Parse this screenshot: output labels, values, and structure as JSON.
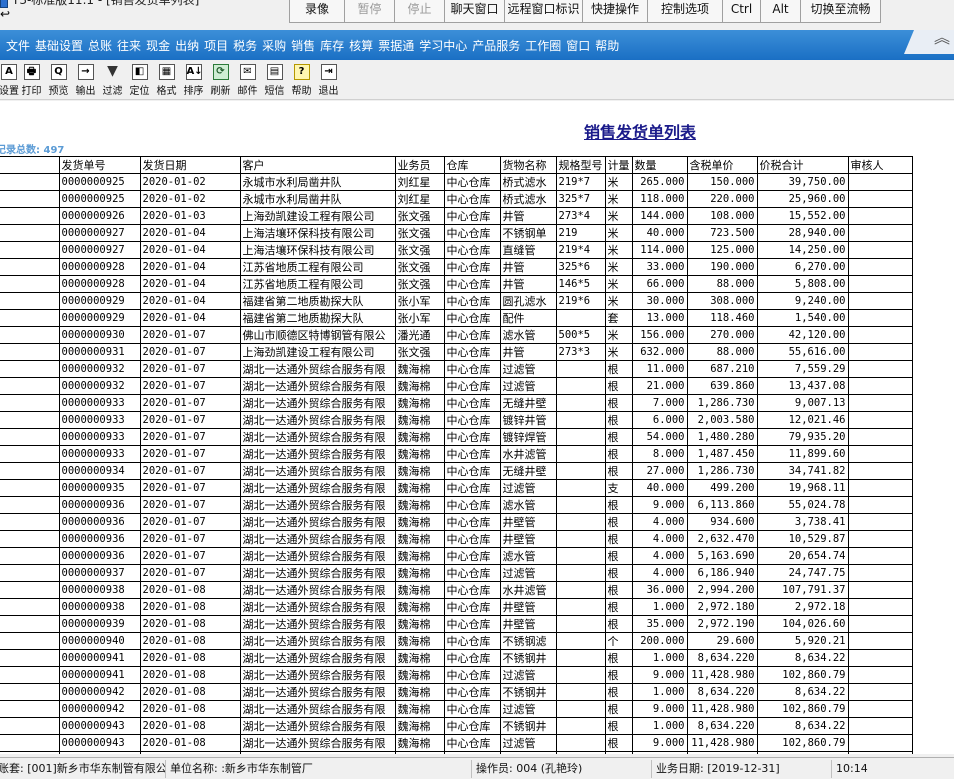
{
  "window": {
    "title": "T3-标准版11.1 - [销售发货单列表]"
  },
  "remote_toolbar": {
    "buttons": [
      {
        "label": "录像",
        "enabled": true
      },
      {
        "label": "暂停",
        "enabled": false
      },
      {
        "label": "停止",
        "enabled": false
      },
      {
        "label": "聊天窗口",
        "enabled": true
      },
      {
        "label": "远程窗口标识",
        "enabled": true
      },
      {
        "label": "快捷操作",
        "enabled": true
      },
      {
        "label": "控制选项",
        "enabled": true
      },
      {
        "label": "Ctrl",
        "enabled": true
      },
      {
        "label": "Alt",
        "enabled": true
      },
      {
        "label": "切换至流畅",
        "enabled": true
      }
    ]
  },
  "menu": {
    "items": [
      "文件",
      "基础设置",
      "总账",
      "往来",
      "现金",
      "出纳",
      "项目",
      "税务",
      "采购",
      "销售",
      "库存",
      "核算",
      "票据通",
      "学习中心",
      "产品服务",
      "工作圈",
      "窗口",
      "帮助"
    ]
  },
  "toolbar": {
    "buttons": [
      {
        "label": "设置",
        "icon": "A"
      },
      {
        "label": "打印",
        "icon": "🖶"
      },
      {
        "label": "预览",
        "icon": "Q"
      },
      {
        "label": "输出",
        "icon": "→"
      },
      {
        "label": "过滤",
        "icon": "▼"
      },
      {
        "label": "定位",
        "icon": "◧"
      },
      {
        "label": "格式",
        "icon": "▦"
      },
      {
        "label": "排序",
        "icon": "A↓"
      },
      {
        "label": "刷新",
        "icon": "⟳"
      },
      {
        "label": "邮件",
        "icon": "✉"
      },
      {
        "label": "短信",
        "icon": "▤"
      },
      {
        "label": "帮助",
        "icon": "?"
      },
      {
        "label": "退出",
        "icon": "⇥"
      }
    ]
  },
  "report": {
    "title": "销售发货单列表",
    "record_count": "记录总数: 497",
    "columns": [
      "发货单号",
      "发货日期",
      "客户",
      "业务员",
      "仓库",
      "货物名称",
      "规格型号",
      "计量",
      "数量",
      "含税单价",
      "价税合计",
      "审核人"
    ],
    "rows": [
      [
        "0000000925",
        "2020-01-02",
        "永城市水利局凿井队",
        "刘红星",
        "中心仓库",
        "桥式滤水",
        "219*7",
        "米",
        "265.000",
        "150.000",
        "39,750.00",
        ""
      ],
      [
        "0000000925",
        "2020-01-02",
        "永城市水利局凿井队",
        "刘红星",
        "中心仓库",
        "桥式滤水",
        "325*7",
        "米",
        "118.000",
        "220.000",
        "25,960.00",
        ""
      ],
      [
        "0000000926",
        "2020-01-03",
        "上海劲凯建设工程有限公司",
        "张文强",
        "中心仓库",
        "井管",
        "273*4",
        "米",
        "144.000",
        "108.000",
        "15,552.00",
        ""
      ],
      [
        "0000000927",
        "2020-01-04",
        "上海洁壤环保科技有限公司",
        "张文强",
        "中心仓库",
        "不锈钢单",
        "219",
        "米",
        "40.000",
        "723.500",
        "28,940.00",
        ""
      ],
      [
        "0000000927",
        "2020-01-04",
        "上海洁壤环保科技有限公司",
        "张文强",
        "中心仓库",
        "直缝管",
        "219*4",
        "米",
        "114.000",
        "125.000",
        "14,250.00",
        ""
      ],
      [
        "0000000928",
        "2020-01-04",
        "江苏省地质工程有限公司",
        "张文强",
        "中心仓库",
        "井管",
        "325*6",
        "米",
        "33.000",
        "190.000",
        "6,270.00",
        ""
      ],
      [
        "0000000928",
        "2020-01-04",
        "江苏省地质工程有限公司",
        "张文强",
        "中心仓库",
        "井管",
        "146*5",
        "米",
        "66.000",
        "88.000",
        "5,808.00",
        ""
      ],
      [
        "0000000929",
        "2020-01-04",
        "福建省第二地质勘探大队",
        "张小军",
        "中心仓库",
        "圆孔滤水",
        "219*6",
        "米",
        "30.000",
        "308.000",
        "9,240.00",
        ""
      ],
      [
        "0000000929",
        "2020-01-04",
        "福建省第二地质勘探大队",
        "张小军",
        "中心仓库",
        "配件",
        "",
        "套",
        "13.000",
        "118.460",
        "1,540.00",
        ""
      ],
      [
        "0000000930",
        "2020-01-07",
        "佛山市顺德区特博钢管有限公",
        "潘光通",
        "中心仓库",
        "滤水管",
        "500*5",
        "米",
        "156.000",
        "270.000",
        "42,120.00",
        ""
      ],
      [
        "0000000931",
        "2020-01-07",
        "上海劲凯建设工程有限公司",
        "张文强",
        "中心仓库",
        "井管",
        "273*3",
        "米",
        "632.000",
        "88.000",
        "55,616.00",
        ""
      ],
      [
        "0000000932",
        "2020-01-07",
        "湖北一达通外贸综合服务有限",
        "魏海棉",
        "中心仓库",
        "过滤管",
        "",
        "根",
        "11.000",
        "687.210",
        "7,559.29",
        ""
      ],
      [
        "0000000932",
        "2020-01-07",
        "湖北一达通外贸综合服务有限",
        "魏海棉",
        "中心仓库",
        "过滤管",
        "",
        "根",
        "21.000",
        "639.860",
        "13,437.08",
        ""
      ],
      [
        "0000000933",
        "2020-01-07",
        "湖北一达通外贸综合服务有限",
        "魏海棉",
        "中心仓库",
        "无缝井壁",
        "",
        "根",
        "7.000",
        "1,286.730",
        "9,007.13",
        ""
      ],
      [
        "0000000933",
        "2020-01-07",
        "湖北一达通外贸综合服务有限",
        "魏海棉",
        "中心仓库",
        "镀锌井管",
        "",
        "根",
        "6.000",
        "2,003.580",
        "12,021.46",
        ""
      ],
      [
        "0000000933",
        "2020-01-07",
        "湖北一达通外贸综合服务有限",
        "魏海棉",
        "中心仓库",
        "镀锌焊管",
        "",
        "根",
        "54.000",
        "1,480.280",
        "79,935.20",
        ""
      ],
      [
        "0000000933",
        "2020-01-07",
        "湖北一达通外贸综合服务有限",
        "魏海棉",
        "中心仓库",
        "水井滤管",
        "",
        "根",
        "8.000",
        "1,487.450",
        "11,899.60",
        ""
      ],
      [
        "0000000934",
        "2020-01-07",
        "湖北一达通外贸综合服务有限",
        "魏海棉",
        "中心仓库",
        "无缝井壁",
        "",
        "根",
        "27.000",
        "1,286.730",
        "34,741.82",
        ""
      ],
      [
        "0000000935",
        "2020-01-07",
        "湖北一达通外贸综合服务有限",
        "魏海棉",
        "中心仓库",
        "过滤管",
        "",
        "支",
        "40.000",
        "499.200",
        "19,968.11",
        ""
      ],
      [
        "0000000936",
        "2020-01-07",
        "湖北一达通外贸综合服务有限",
        "魏海棉",
        "中心仓库",
        "滤水管",
        "",
        "根",
        "9.000",
        "6,113.860",
        "55,024.78",
        ""
      ],
      [
        "0000000936",
        "2020-01-07",
        "湖北一达通外贸综合服务有限",
        "魏海棉",
        "中心仓库",
        "井壁管",
        "",
        "根",
        "4.000",
        "934.600",
        "3,738.41",
        ""
      ],
      [
        "0000000936",
        "2020-01-07",
        "湖北一达通外贸综合服务有限",
        "魏海棉",
        "中心仓库",
        "井壁管",
        "",
        "根",
        "4.000",
        "2,632.470",
        "10,529.87",
        ""
      ],
      [
        "0000000936",
        "2020-01-07",
        "湖北一达通外贸综合服务有限",
        "魏海棉",
        "中心仓库",
        "滤水管",
        "",
        "根",
        "4.000",
        "5,163.690",
        "20,654.74",
        ""
      ],
      [
        "0000000937",
        "2020-01-07",
        "湖北一达通外贸综合服务有限",
        "魏海棉",
        "中心仓库",
        "过滤管",
        "",
        "根",
        "4.000",
        "6,186.940",
        "24,747.75",
        ""
      ],
      [
        "0000000938",
        "2020-01-08",
        "湖北一达通外贸综合服务有限",
        "魏海棉",
        "中心仓库",
        "水井滤管",
        "",
        "根",
        "36.000",
        "2,994.200",
        "107,791.37",
        ""
      ],
      [
        "0000000938",
        "2020-01-08",
        "湖北一达通外贸综合服务有限",
        "魏海棉",
        "中心仓库",
        "井壁管",
        "",
        "根",
        "1.000",
        "2,972.180",
        "2,972.18",
        ""
      ],
      [
        "0000000939",
        "2020-01-08",
        "湖北一达通外贸综合服务有限",
        "魏海棉",
        "中心仓库",
        "井壁管",
        "",
        "根",
        "35.000",
        "2,972.190",
        "104,026.60",
        ""
      ],
      [
        "0000000940",
        "2020-01-08",
        "湖北一达通外贸综合服务有限",
        "魏海棉",
        "中心仓库",
        "不锈钢滤",
        "",
        "个",
        "200.000",
        "29.600",
        "5,920.21",
        ""
      ],
      [
        "0000000941",
        "2020-01-08",
        "湖北一达通外贸综合服务有限",
        "魏海棉",
        "中心仓库",
        "不锈钢井",
        "",
        "根",
        "1.000",
        "8,634.220",
        "8,634.22",
        ""
      ],
      [
        "0000000941",
        "2020-01-08",
        "湖北一达通外贸综合服务有限",
        "魏海棉",
        "中心仓库",
        "过滤管",
        "",
        "根",
        "9.000",
        "11,428.980",
        "102,860.79",
        ""
      ],
      [
        "0000000942",
        "2020-01-08",
        "湖北一达通外贸综合服务有限",
        "魏海棉",
        "中心仓库",
        "不锈钢井",
        "",
        "根",
        "1.000",
        "8,634.220",
        "8,634.22",
        ""
      ],
      [
        "0000000942",
        "2020-01-08",
        "湖北一达通外贸综合服务有限",
        "魏海棉",
        "中心仓库",
        "过滤管",
        "",
        "根",
        "9.000",
        "11,428.980",
        "102,860.79",
        ""
      ],
      [
        "0000000943",
        "2020-01-08",
        "湖北一达通外贸综合服务有限",
        "魏海棉",
        "中心仓库",
        "不锈钢井",
        "",
        "根",
        "1.000",
        "8,634.220",
        "8,634.22",
        ""
      ],
      [
        "0000000943",
        "2020-01-08",
        "湖北一达通外贸综合服务有限",
        "魏海棉",
        "中心仓库",
        "过滤管",
        "",
        "根",
        "9.000",
        "11,428.980",
        "102,860.79",
        ""
      ],
      [
        "0000000944",
        "2020-01-08",
        "湖北一达通外贸综合服务有限",
        "魏海棉",
        "中心仓库",
        "不锈钢井",
        "",
        "根",
        "1.000",
        "8,634.220",
        "8,634.22",
        ""
      ]
    ]
  },
  "statusbar": {
    "account": "账套: [001]新乡市华东制管有限公司",
    "unit": "单位名称: :新乡市华东制管厂",
    "operator": "操作员: 004 (孔艳玲)",
    "business_date": "业务日期: [2019-12-31]",
    "time": "10:14"
  }
}
